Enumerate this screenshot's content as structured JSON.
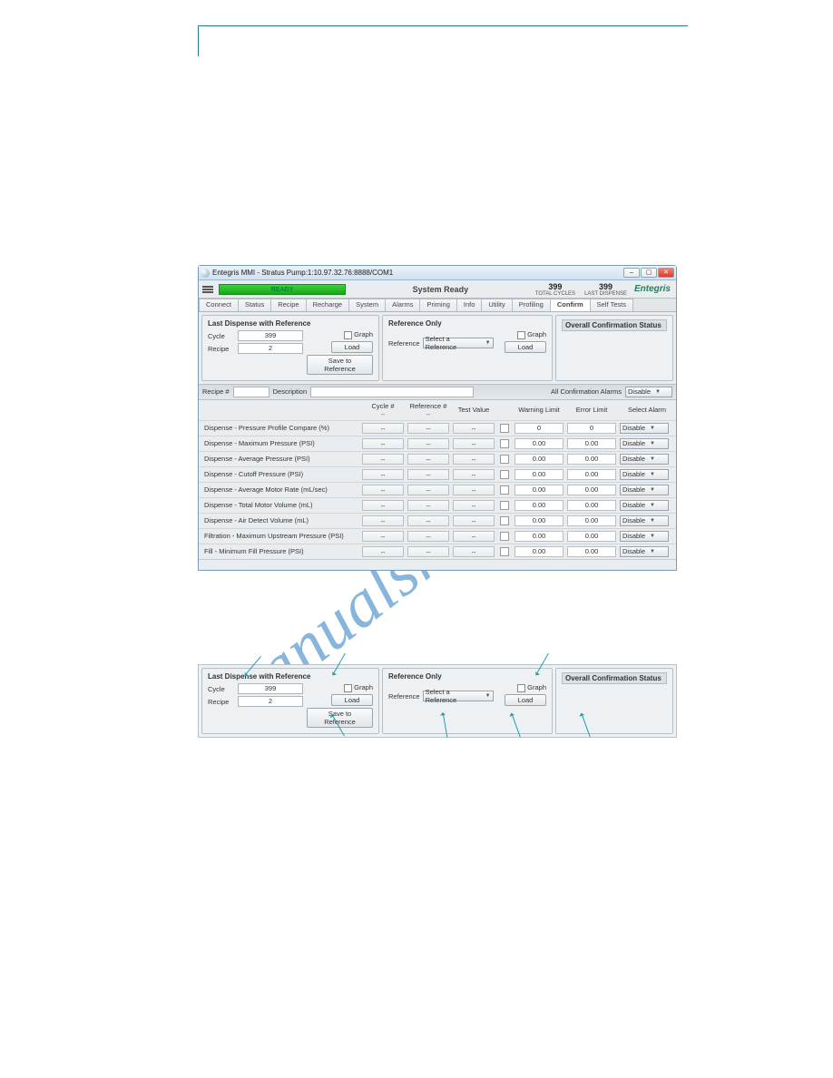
{
  "watermark": "manualshive.com",
  "window": {
    "title": "Entegris MMI - Stratus Pump:1:10.97.32.76:8888/COM1",
    "status_pill": "READY",
    "system_status": "System Ready",
    "stats": {
      "total_cycles": {
        "value": "399",
        "label": "TOTAL CYCLES"
      },
      "last_dispense": {
        "value": "399",
        "label": "LAST DISPENSE"
      }
    },
    "brand": "Entegris"
  },
  "tabs": [
    "Connect",
    "Status",
    "Recipe",
    "Recharge",
    "System",
    "Alarms",
    "Priming",
    "Info",
    "Utility",
    "Profiling",
    "Confirm",
    "Self Tests"
  ],
  "tabs_active_index": 10,
  "panels": {
    "last_dispense": {
      "title": "Last Dispense with Reference",
      "cycle_label": "Cycle",
      "cycle_value": "399",
      "recipe_label": "Recipe",
      "recipe_value": "2",
      "graph_label": "Graph",
      "load_label": "Load",
      "save_label": "Save to Reference"
    },
    "reference_only": {
      "title": "Reference Only",
      "reference_label": "Reference",
      "select_placeholder": "Select a Reference",
      "graph_label": "Graph",
      "load_label": "Load"
    },
    "status": {
      "title": "Overall Confirmation Status"
    }
  },
  "meta_row": {
    "recipe_num_label": "Recipe #",
    "recipe_num_value": "",
    "description_label": "Description",
    "description_value": "",
    "all_alarms_label": "All Confirmation Alarms",
    "all_alarms_value": "Disable"
  },
  "grid": {
    "headers": {
      "cycle": "Cycle #",
      "reference": "Reference #",
      "test_value": "Test Value",
      "warning": "Warning Limit",
      "error": "Error Limit",
      "select_alarm": "Select Alarm",
      "dash": "--"
    },
    "rows": [
      {
        "param": "Dispense - Pressure Profile Compare  (%)",
        "cycle": "--",
        "ref": "--",
        "test": "--",
        "warn": "0",
        "err": "0",
        "alarm": "Disable"
      },
      {
        "param": "Dispense - Maximum Pressure  (PSI)",
        "cycle": "--",
        "ref": "--",
        "test": "--",
        "warn": "0.00",
        "err": "0.00",
        "alarm": "Disable"
      },
      {
        "param": "Dispense - Average Pressure  (PSI)",
        "cycle": "--",
        "ref": "--",
        "test": "--",
        "warn": "0.00",
        "err": "0.00",
        "alarm": "Disable"
      },
      {
        "param": "Dispense - Cutoff Pressure  (PSI)",
        "cycle": "--",
        "ref": "--",
        "test": "--",
        "warn": "0.00",
        "err": "0.00",
        "alarm": "Disable"
      },
      {
        "param": "Dispense - Average Motor Rate  (mL/sec)",
        "cycle": "--",
        "ref": "--",
        "test": "--",
        "warn": "0.00",
        "err": "0.00",
        "alarm": "Disable"
      },
      {
        "param": "Dispense - Total Motor Volume  (mL)",
        "cycle": "--",
        "ref": "--",
        "test": "--",
        "warn": "0.00",
        "err": "0.00",
        "alarm": "Disable"
      },
      {
        "param": "Dispense - Air Detect Volume  (mL)",
        "cycle": "--",
        "ref": "--",
        "test": "--",
        "warn": "0.00",
        "err": "0.00",
        "alarm": "Disable"
      },
      {
        "param": "Filtration - Maximum Upstream Pressure  (PSI)",
        "cycle": "--",
        "ref": "--",
        "test": "--",
        "warn": "0.00",
        "err": "0.00",
        "alarm": "Disable"
      },
      {
        "param": "Fill - Minimum Fill Pressure  (PSI)",
        "cycle": "--",
        "ref": "--",
        "test": "--",
        "warn": "0.00",
        "err": "0.00",
        "alarm": "Disable"
      }
    ]
  },
  "win_controls": {
    "min": "–",
    "max": "▢",
    "close": "✕"
  }
}
